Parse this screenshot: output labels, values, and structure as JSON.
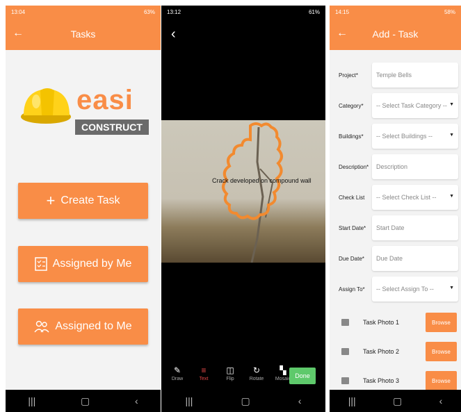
{
  "phone1": {
    "status": {
      "time": "13:04",
      "battery": "63%"
    },
    "appbar": {
      "title": "Tasks"
    },
    "logo": {
      "word1": "easi",
      "word2": "CONSTRUCT"
    },
    "buttons": [
      {
        "label": "Create Task",
        "icon": "plus-icon"
      },
      {
        "label": "Assigned by Me",
        "icon": "checklist-icon"
      },
      {
        "label": "Assigned to Me",
        "icon": "team-icon"
      }
    ]
  },
  "phone2": {
    "status": {
      "time": "13:12",
      "battery": "61%"
    },
    "photo_caption": "Crack developed on compound wall",
    "tools": [
      {
        "label": "Draw",
        "icon": "brush-icon"
      },
      {
        "label": "Text",
        "icon": "text-icon",
        "active": true
      },
      {
        "label": "Flip",
        "icon": "flip-icon"
      },
      {
        "label": "Rotate",
        "icon": "rotate-icon"
      },
      {
        "label": "Mosaic",
        "icon": "mosaic-icon"
      }
    ],
    "done_label": "Done"
  },
  "phone3": {
    "status": {
      "time": "14:15",
      "battery": "58%"
    },
    "appbar": {
      "title": "Add - Task"
    },
    "fields": [
      {
        "label": "Project*",
        "value": "Temple Bells",
        "type": "text"
      },
      {
        "label": "Category*",
        "value": "-- Select Task Category --",
        "type": "select"
      },
      {
        "label": "Buildings*",
        "value": "-- Select Buildings --",
        "type": "select"
      },
      {
        "label": "Description*",
        "value": "Description",
        "type": "text"
      },
      {
        "label": "Check List",
        "value": "-- Select Check List --",
        "type": "select"
      },
      {
        "label": "Start Date*",
        "value": "Start Date",
        "type": "text"
      },
      {
        "label": "Due Date*",
        "value": "Due Date",
        "type": "text"
      },
      {
        "label": "Assign To*",
        "value": "-- Select Assign To --",
        "type": "select"
      }
    ],
    "photos": [
      {
        "label": "Task Photo 1",
        "button": "Browse"
      },
      {
        "label": "Task Photo 2",
        "button": "Browse"
      },
      {
        "label": "Task Photo 3",
        "button": "Browse"
      }
    ]
  },
  "colors": {
    "accent": "#f98d47",
    "done": "#5ec96b",
    "active_tool": "#e84848"
  }
}
